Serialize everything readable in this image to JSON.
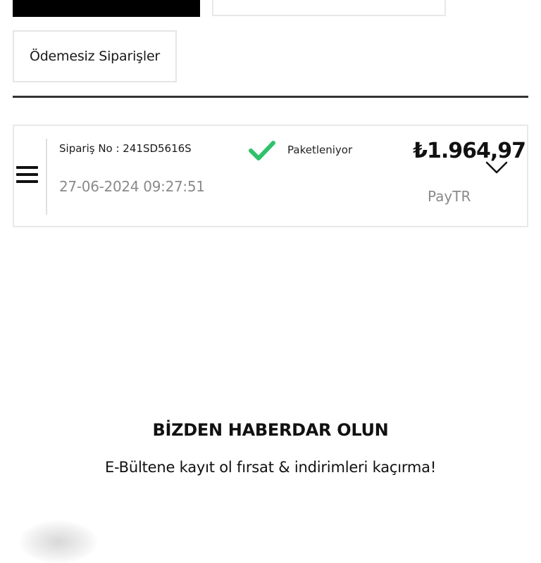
{
  "tabs": {
    "unpaid_orders_label": "Ödemesiz Siparişler"
  },
  "order": {
    "order_no": "Sipariş No : 241SD5616S",
    "date": "27-06-2024 09:27:51",
    "status": "Paketleniyor",
    "price": "₺1.964,97",
    "payment_method": "PayTR"
  },
  "icons": {
    "menu": "hamburger-menu-icon",
    "status": "checkmark-icon",
    "expand": "chevron-down-icon"
  },
  "colors": {
    "status_check": "#2fc26b",
    "muted_text": "#8a8a8a",
    "tab_active": "#000000"
  },
  "newsletter": {
    "title": "BİZDEN HABERDAR OLUN",
    "subtitle": "E-Bültene kayıt ol fırsat & indirimleri kaçırma!"
  }
}
